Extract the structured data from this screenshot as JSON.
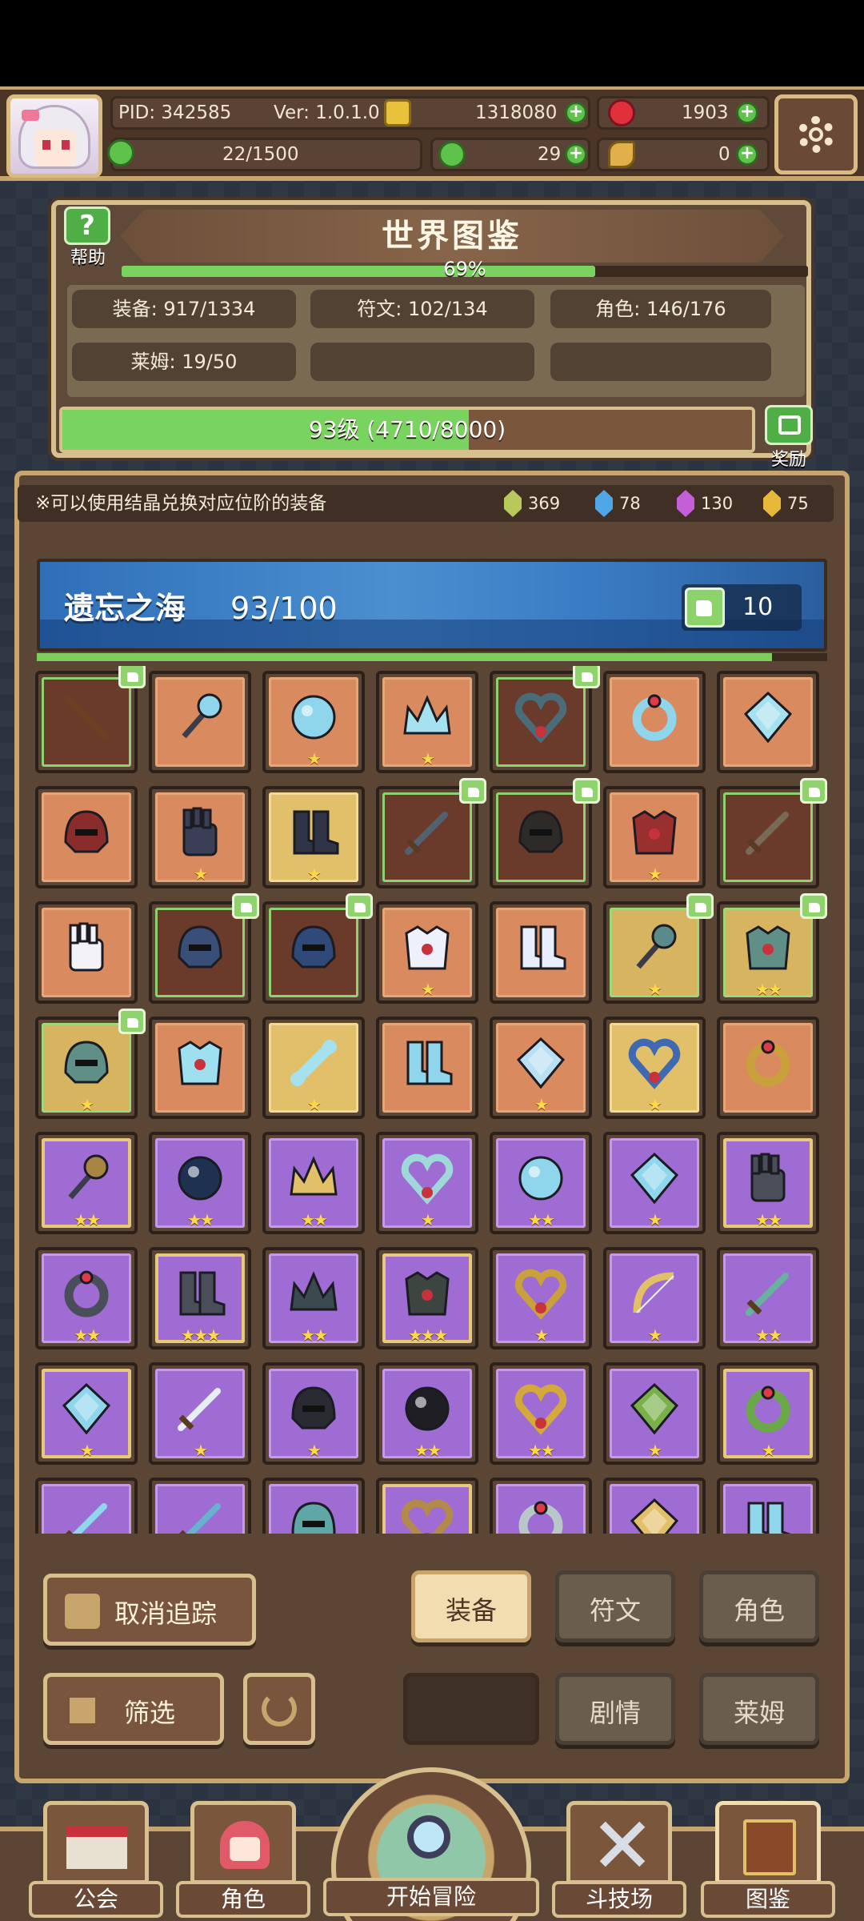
{
  "status": {
    "pid": "PID: 342585",
    "ver": "Ver: 1.0.1.0",
    "gold": "1318080",
    "ruby": "1903",
    "stamina": "22/1500",
    "clover": "29",
    "horn": "0"
  },
  "atlas": {
    "title": "世界图鉴",
    "help_label": "帮助",
    "percent_label": "69%",
    "percent": 0.69,
    "stats": {
      "equip": "装备: 917/1334",
      "rune": "符文: 102/134",
      "role": "角色: 146/176",
      "slime": "莱姆: 19/50"
    },
    "level_text": "93级 (4710/8000)",
    "level_progress": 0.589,
    "reward_label": "奖励"
  },
  "tip": "※可以使用结晶兑换对应位阶的装备",
  "crystals": [
    {
      "name": "green-crystal",
      "value": "369",
      "color": "#b8c85a"
    },
    {
      "name": "blue-crystal",
      "value": "78",
      "color": "#4fa7e8"
    },
    {
      "name": "purple-crystal",
      "value": "130",
      "color": "#c45fd8"
    },
    {
      "name": "gold-crystal",
      "value": "75",
      "color": "#e8b83a"
    }
  ],
  "zone": {
    "name": "遗忘之海",
    "count": "93/100",
    "progress": 0.93,
    "likes": "10"
  },
  "items": [
    {
      "name": "staff-item",
      "style": "dark",
      "stars": "",
      "tag": true,
      "icon": "stick",
      "color": "#6b3f25"
    },
    {
      "name": "ice-wand-item",
      "style": "orange",
      "stars": "",
      "tag": false,
      "icon": "wand",
      "color": "#8fd6ec"
    },
    {
      "name": "ice-orb-item",
      "style": "orange",
      "stars": "★",
      "tag": false,
      "icon": "orb",
      "color": "#8fd6ec"
    },
    {
      "name": "ice-crown-item",
      "style": "orange",
      "stars": "★",
      "tag": false,
      "icon": "crown",
      "color": "#a6e1f0"
    },
    {
      "name": "heart-amulet-item",
      "style": "dark",
      "stars": "",
      "tag": true,
      "icon": "heart",
      "color": "#4a6b78"
    },
    {
      "name": "ice-ring-item",
      "style": "orange",
      "stars": "",
      "tag": false,
      "icon": "ring",
      "color": "#8fd6ec"
    },
    {
      "name": "ice-crystal-item",
      "style": "orange",
      "stars": "",
      "tag": false,
      "icon": "gem",
      "color": "#a6e1f0"
    },
    {
      "name": "red-helm-item",
      "style": "orange",
      "stars": "",
      "tag": false,
      "icon": "helm",
      "color": "#8a2c2c"
    },
    {
      "name": "gauntlet-item",
      "style": "orange",
      "stars": "★",
      "tag": false,
      "icon": "glove",
      "color": "#3a3f55"
    },
    {
      "name": "dark-boots-item",
      "style": "gold",
      "stars": "★",
      "tag": false,
      "icon": "boots",
      "color": "#2f3447"
    },
    {
      "name": "dark-sword-item",
      "style": "dark",
      "stars": "",
      "tag": true,
      "icon": "sword",
      "color": "#55606e"
    },
    {
      "name": "horned-helm-item",
      "style": "dark",
      "stars": "",
      "tag": true,
      "icon": "helm",
      "color": "#2e2a28"
    },
    {
      "name": "red-armor-item",
      "style": "orange",
      "stars": "★",
      "tag": false,
      "icon": "armor",
      "color": "#9a2f2f"
    },
    {
      "name": "rusted-sword-item",
      "style": "dark",
      "stars": "",
      "tag": true,
      "icon": "sword",
      "color": "#7a6a55"
    },
    {
      "name": "white-glove-item",
      "style": "orange",
      "stars": "",
      "tag": false,
      "icon": "glove",
      "color": "#f2f2f7"
    },
    {
      "name": "blue-helm-item",
      "style": "dark",
      "stars": "",
      "tag": true,
      "icon": "helm",
      "color": "#3a4f78"
    },
    {
      "name": "gold-blue-helm-item",
      "style": "dark",
      "stars": "",
      "tag": true,
      "icon": "helm",
      "color": "#2f4a78"
    },
    {
      "name": "white-armor-item",
      "style": "orange",
      "stars": "★",
      "tag": false,
      "icon": "armor",
      "color": "#eef0fb"
    },
    {
      "name": "white-boots-item",
      "style": "orange",
      "stars": "",
      "tag": false,
      "icon": "boots",
      "color": "#e8eefc"
    },
    {
      "name": "mace-item",
      "style": "goldg",
      "stars": "★",
      "tag": true,
      "icon": "wand",
      "color": "#5a8a8a"
    },
    {
      "name": "jade-armor-item",
      "style": "goldg",
      "stars": "★★",
      "tag": true,
      "icon": "armor",
      "color": "#5f8f86"
    },
    {
      "name": "jade-helm-item",
      "style": "goldg",
      "stars": "★",
      "tag": true,
      "icon": "helm",
      "color": "#5f8f86"
    },
    {
      "name": "ice-armor-item",
      "style": "orange",
      "stars": "",
      "tag": false,
      "icon": "armor",
      "color": "#9fe0f0"
    },
    {
      "name": "ice-bone-item",
      "style": "gold",
      "stars": "★",
      "tag": false,
      "icon": "bone",
      "color": "#a6e1f0"
    },
    {
      "name": "ice-boots-item",
      "style": "orange",
      "stars": "",
      "tag": false,
      "icon": "boots",
      "color": "#8fd6ec"
    },
    {
      "name": "ice-emblem-item",
      "style": "orange",
      "stars": "★",
      "tag": false,
      "icon": "gem",
      "color": "#b9dff2"
    },
    {
      "name": "sapphire-necklace-item",
      "style": "gold",
      "stars": "★",
      "tag": false,
      "icon": "heart",
      "color": "#3f6ab2"
    },
    {
      "name": "gold-ring-item",
      "style": "orange",
      "stars": "",
      "tag": false,
      "icon": "ring",
      "color": "#c9a03c"
    },
    {
      "name": "scepter-item",
      "style": "purplego",
      "stars": "★★",
      "tag": false,
      "icon": "wand",
      "color": "#a88445"
    },
    {
      "name": "dark-orb-item",
      "style": "purple",
      "stars": "★★",
      "tag": false,
      "icon": "orb",
      "color": "#1f3150"
    },
    {
      "name": "gold-crown-item",
      "style": "purple",
      "stars": "★★",
      "tag": false,
      "icon": "crown",
      "color": "#e2c06a"
    },
    {
      "name": "silver-necklace-item",
      "style": "purple",
      "stars": "★",
      "tag": false,
      "icon": "heart",
      "color": "#9fd8d8"
    },
    {
      "name": "crystal-ball-item",
      "style": "purple",
      "stars": "★★",
      "tag": false,
      "icon": "orb",
      "color": "#8fd6ec"
    },
    {
      "name": "diamond-amulet-item",
      "style": "purple",
      "stars": "★",
      "tag": false,
      "icon": "gem",
      "color": "#8fd6ec"
    },
    {
      "name": "iron-glove-item",
      "style": "purplego",
      "stars": "★★",
      "tag": false,
      "icon": "glove",
      "color": "#4a4e58"
    },
    {
      "name": "iron-ring-item",
      "style": "purple",
      "stars": "★★",
      "tag": false,
      "icon": "ring",
      "color": "#4a4e58"
    },
    {
      "name": "iron-boots-item",
      "style": "purplego",
      "stars": "★★★",
      "tag": false,
      "icon": "boots",
      "color": "#4a4e58"
    },
    {
      "name": "dark-crown-item",
      "style": "purple",
      "stars": "★★",
      "tag": false,
      "icon": "crown",
      "color": "#3a4a4f"
    },
    {
      "name": "eye-armor-item",
      "style": "purplego",
      "stars": "★★★",
      "tag": false,
      "icon": "armor",
      "color": "#3d4540"
    },
    {
      "name": "ruby-necklace-item",
      "style": "purple",
      "stars": "★",
      "tag": false,
      "icon": "heart",
      "color": "#c9a03c"
    },
    {
      "name": "gold-bow-item",
      "style": "purple",
      "stars": "★",
      "tag": false,
      "icon": "bow",
      "color": "#e2c06a"
    },
    {
      "name": "spear-item",
      "style": "purple",
      "stars": "★★",
      "tag": false,
      "icon": "sword",
      "color": "#6ab0a0"
    },
    {
      "name": "ice-lantern-item",
      "style": "purplego",
      "stars": "★",
      "tag": false,
      "icon": "gem",
      "color": "#8fd6ec"
    },
    {
      "name": "scimitar-item",
      "style": "purple",
      "stars": "★",
      "tag": false,
      "icon": "sword",
      "color": "#e8eef5"
    },
    {
      "name": "feather-helm-item",
      "style": "purple",
      "stars": "★",
      "tag": false,
      "icon": "helm",
      "color": "#2a2a33"
    },
    {
      "name": "black-pendant-item",
      "style": "purple",
      "stars": "★★",
      "tag": false,
      "icon": "orb",
      "color": "#1e1e24"
    },
    {
      "name": "sun-necklace-item",
      "style": "purple",
      "stars": "★★",
      "tag": false,
      "icon": "heart",
      "color": "#d4a83a"
    },
    {
      "name": "green-relic-item",
      "style": "purple",
      "stars": "★",
      "tag": false,
      "icon": "gem",
      "color": "#78b04a"
    },
    {
      "name": "jade-ring-item",
      "style": "purplego",
      "stars": "★",
      "tag": false,
      "icon": "ring",
      "color": "#6aa84a"
    },
    {
      "name": "blue-sword-item",
      "style": "purple",
      "stars": "",
      "tag": false,
      "icon": "sword",
      "color": "#8fd6ec"
    },
    {
      "name": "blue-spear-item",
      "style": "purple",
      "stars": "",
      "tag": false,
      "icon": "sword",
      "color": "#6ab0d0"
    },
    {
      "name": "teal-helm-item",
      "style": "purple",
      "stars": "",
      "tag": false,
      "icon": "helm",
      "color": "#5fa6a6"
    },
    {
      "name": "bronze-necklace-item",
      "style": "purplego",
      "stars": "",
      "tag": false,
      "icon": "heart",
      "color": "#b48a4a"
    },
    {
      "name": "silver-ring-item",
      "style": "purple",
      "stars": "",
      "tag": false,
      "icon": "ring",
      "color": "#b8c8c8"
    },
    {
      "name": "gold-emblem-item",
      "style": "purple",
      "stars": "",
      "tag": false,
      "icon": "gem",
      "color": "#e2c06a"
    },
    {
      "name": "ice-boots-2-item",
      "style": "purple",
      "stars": "",
      "tag": false,
      "icon": "boots",
      "color": "#8fd6ec"
    }
  ],
  "buttons": {
    "untrack": "取消追踪",
    "filter": "筛选",
    "equip": "装备",
    "rune": "符文",
    "role": "角色",
    "story": "剧情",
    "slime": "莱姆"
  },
  "nav": {
    "guild": "公会",
    "role": "角色",
    "adventure": "开始冒险",
    "arena": "斗技场",
    "atlas": "图鉴"
  },
  "colors": {
    "panel": "#5b4535",
    "frame": "#c7a56d",
    "progress": "#79d45f"
  }
}
